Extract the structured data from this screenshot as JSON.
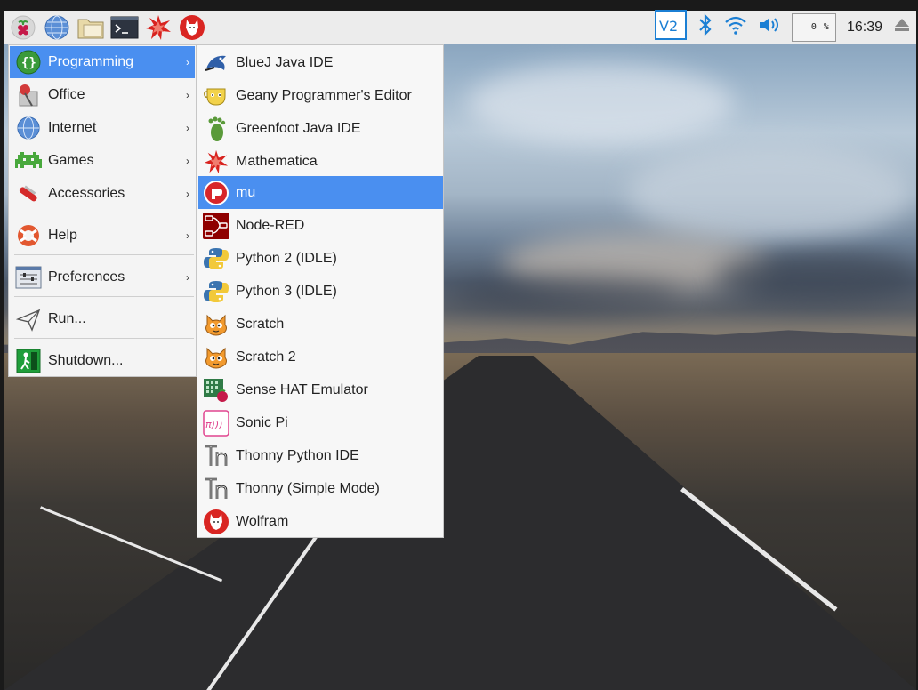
{
  "taskbar": {
    "launchers": [
      {
        "name": "raspberry-menu-icon"
      },
      {
        "name": "web-browser-icon"
      },
      {
        "name": "file-manager-icon"
      },
      {
        "name": "terminal-icon"
      },
      {
        "name": "mathematica-icon"
      },
      {
        "name": "wolfram-icon"
      }
    ],
    "cpu_text": "0 %",
    "clock": "16:39"
  },
  "menu": {
    "items": [
      {
        "label": "Programming",
        "icon": "programming-icon",
        "has_submenu": true
      },
      {
        "label": "Office",
        "icon": "office-icon",
        "has_submenu": true
      },
      {
        "label": "Internet",
        "icon": "internet-icon",
        "has_submenu": true
      },
      {
        "label": "Games",
        "icon": "games-icon",
        "has_submenu": true
      },
      {
        "label": "Accessories",
        "icon": "accessories-icon",
        "has_submenu": true
      },
      {
        "label": "Help",
        "icon": "help-icon",
        "has_submenu": true
      },
      {
        "label": "Preferences",
        "icon": "preferences-icon",
        "has_submenu": true
      },
      {
        "label": "Run...",
        "icon": "run-icon",
        "has_submenu": false
      },
      {
        "label": "Shutdown...",
        "icon": "shutdown-icon",
        "has_submenu": false
      }
    ],
    "arrow": "›"
  },
  "submenu": {
    "items": [
      {
        "label": "BlueJ Java IDE",
        "icon": "bluej-icon"
      },
      {
        "label": "Geany Programmer's Editor",
        "icon": "geany-icon"
      },
      {
        "label": "Greenfoot Java IDE",
        "icon": "greenfoot-icon"
      },
      {
        "label": "Mathematica",
        "icon": "mathematica-icon"
      },
      {
        "label": "mu",
        "icon": "mu-icon"
      },
      {
        "label": "Node-RED",
        "icon": "node-red-icon"
      },
      {
        "label": "Python 2 (IDLE)",
        "icon": "python-icon"
      },
      {
        "label": "Python 3 (IDLE)",
        "icon": "python-icon"
      },
      {
        "label": "Scratch",
        "icon": "scratch-icon"
      },
      {
        "label": "Scratch 2",
        "icon": "scratch-icon"
      },
      {
        "label": "Sense HAT Emulator",
        "icon": "sense-hat-icon"
      },
      {
        "label": "Sonic Pi",
        "icon": "sonic-pi-icon"
      },
      {
        "label": "Thonny Python IDE",
        "icon": "thonny-icon"
      },
      {
        "label": "Thonny (Simple Mode)",
        "icon": "thonny-icon"
      },
      {
        "label": "Wolfram",
        "icon": "wolfram-icon"
      }
    ]
  },
  "colors": {
    "highlight": "#4a8ff0",
    "panel": "#ececec",
    "menu_bg": "#f4f4f4"
  }
}
